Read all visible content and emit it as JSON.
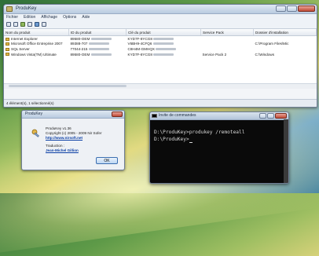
{
  "main_window": {
    "title": "ProduKey",
    "menu": [
      "Fichier",
      "Edition",
      "Affichage",
      "Options",
      "Aide"
    ],
    "columns": [
      "Nom du produit",
      "ID du produit",
      "Clé du produit",
      "Service Pack",
      "Dossier d'installation"
    ],
    "rows": [
      {
        "name": "Internet Explorer",
        "id": "89580-OEM",
        "key": "KYD7F-8YCG8",
        "sp": "",
        "folder": ""
      },
      {
        "name": "Microsoft Office Entreprise 2007",
        "id": "89388-707",
        "key": "V6BH9-4CFQ6",
        "sp": "",
        "folder": "C:\\Program Files\\Mic"
      },
      {
        "name": "SQL Server",
        "id": "77044-215",
        "key": "C8H4M-GMHQX",
        "sp": "",
        "folder": ""
      },
      {
        "name": "Windows Vista(TM) Ultimate",
        "id": "89580-OEM",
        "key": "KYD7F-8YCG8",
        "sp": "Service Pack 2",
        "folder": "C:\\Windows"
      }
    ],
    "status": "4 élément(s), 1 sélectionné(s)"
  },
  "about_dialog": {
    "title": "ProduKey",
    "version": "ProduKey v1.36",
    "copyright": "Copyright (c) 2005 - 2009 Nir Sofer",
    "url": "http://www.nirsoft.net",
    "translation_label": "Traduction :",
    "translator": "Jean-Michel Gillion",
    "ok_label": "OK"
  },
  "console": {
    "title": "Invite de commandes",
    "lines": [
      "D:\\ProduKey>produkey /remoteall",
      "",
      "D:\\ProduKey>"
    ]
  },
  "colors": {
    "accent": "#0b3fa5",
    "titlebar": "#b9cbe0"
  }
}
